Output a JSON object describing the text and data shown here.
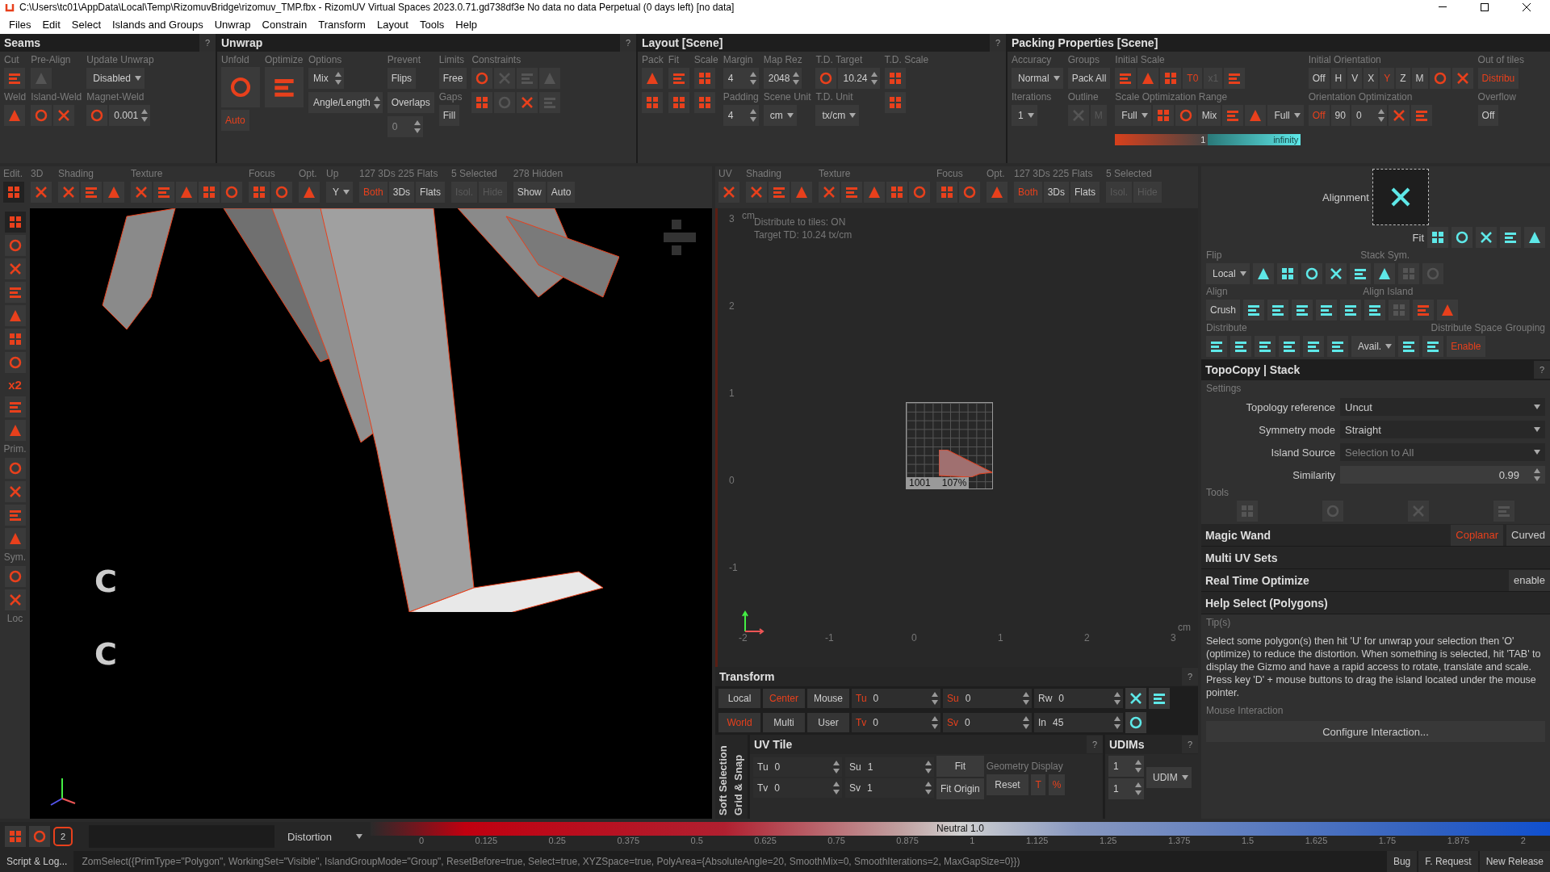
{
  "title_bar": {
    "title": "C:\\Users\\tc01\\AppData\\Local\\Temp\\RizomuvBridge\\rizomuv_TMP.fbx - RizomUV  Virtual Spaces 2023.0.71.gd738df3e No data no data Perpetual  (0 days left) [no data]"
  },
  "menu": [
    "Files",
    "Edit",
    "Select",
    "Islands and Groups",
    "Unwrap",
    "Constrain",
    "Transform",
    "Layout",
    "Tools",
    "Help"
  ],
  "top_panels": [
    {
      "title": "Seams",
      "help": "?",
      "columns": [
        [
          {
            "caption": "Cut",
            "items": [
              {
                "kind": "icon"
              }
            ]
          },
          {
            "caption": "Weld",
            "items": [
              {
                "kind": "icon"
              }
            ]
          }
        ],
        [
          {
            "caption": "Pre-Align",
            "items": [
              {
                "kind": "icon",
                "disabled": true
              }
            ]
          },
          {
            "caption": "Island-Weld",
            "items": [
              {
                "kind": "icon"
              },
              {
                "kind": "icon"
              }
            ]
          }
        ],
        [
          {
            "caption": "Update Unwrap",
            "items": [
              {
                "kind": "dropdown",
                "text": "Disabled"
              }
            ]
          },
          {
            "caption": "Magnet-Weld",
            "items": [
              {
                "kind": "icon"
              },
              {
                "kind": "spin",
                "text": "0.001"
              }
            ]
          }
        ]
      ]
    },
    {
      "title": "Unwrap",
      "help": "?",
      "columns": [
        [
          {
            "caption": "Unfold",
            "items": [
              {
                "kind": "bigicon"
              }
            ]
          },
          {
            "items": [
              {
                "kind": "button",
                "text": "Auto",
                "active": true
              }
            ]
          }
        ],
        [
          {
            "caption": "Optimize",
            "items": [
              {
                "kind": "bigicon"
              }
            ]
          }
        ],
        [
          {
            "caption": "Options",
            "items": [
              {
                "kind": "spin",
                "text": "Mix"
              }
            ]
          },
          {
            "items": [
              {
                "kind": "spin",
                "text": "Angle/Length"
              }
            ]
          }
        ],
        [
          {
            "caption": "Prevent",
            "items": [
              {
                "kind": "button",
                "text": "Flips"
              }
            ]
          },
          {
            "items": [
              {
                "kind": "button",
                "text": "Overlaps"
              }
            ]
          },
          {
            "items": [
              {
                "kind": "spin",
                "text": "0",
                "disabled": true
              }
            ]
          }
        ],
        [
          {
            "caption": "Limits",
            "items": [
              {
                "kind": "button",
                "text": "Free"
              }
            ]
          },
          {
            "caption": "Gaps",
            "items": [
              {
                "kind": "button",
                "text": "Fill"
              }
            ]
          }
        ],
        [
          {
            "caption": "Constraints",
            "items": [
              {
                "kind": "icon"
              },
              {
                "kind": "icon",
                "disabled": true
              },
              {
                "kind": "icon",
                "disabled": true
              },
              {
                "kind": "icon",
                "disabled": true
              }
            ]
          },
          {
            "items": [
              {
                "kind": "icon"
              },
              {
                "kind": "icon",
                "disabled": true
              },
              {
                "kind": "icon"
              },
              {
                "kind": "icon",
                "disabled": true
              }
            ]
          }
        ]
      ]
    },
    {
      "title": "Layout [Scene]",
      "help": "?",
      "columns": [
        [
          {
            "caption": "Pack",
            "items": [
              {
                "kind": "icon"
              }
            ]
          },
          {
            "items": [
              {
                "kind": "icon"
              }
            ]
          }
        ],
        [
          {
            "caption": "Fit",
            "items": [
              {
                "kind": "icon"
              }
            ]
          },
          {
            "items": [
              {
                "kind": "icon"
              }
            ]
          }
        ],
        [
          {
            "caption": "Scale",
            "items": [
              {
                "kind": "icon"
              }
            ]
          },
          {
            "items": [
              {
                "kind": "icon"
              }
            ]
          }
        ],
        [
          {
            "caption": "Margin",
            "items": [
              {
                "kind": "spin",
                "text": "4"
              }
            ]
          },
          {
            "caption": "Padding",
            "items": [
              {
                "kind": "spin",
                "text": "4"
              }
            ]
          }
        ],
        [
          {
            "caption": "Map Rez",
            "items": [
              {
                "kind": "spin",
                "text": "2048"
              }
            ]
          },
          {
            "caption": "Scene Unit",
            "items": [
              {
                "kind": "dropdown",
                "text": "cm"
              }
            ]
          }
        ],
        [
          {
            "caption": "T.D. Target",
            "items": [
              {
                "kind": "icon"
              },
              {
                "kind": "spin",
                "text": "10.24"
              }
            ]
          },
          {
            "caption": "T.D. Unit",
            "items": [
              {
                "kind": "dropdown",
                "text": "tx/cm"
              }
            ]
          }
        ],
        [
          {
            "caption": "T.D. Scale",
            "items": [
              {
                "kind": "icon"
              }
            ]
          },
          {
            "items": [
              {
                "kind": "icon"
              }
            ]
          }
        ]
      ]
    },
    {
      "title": "Packing Properties [Scene]",
      "columns": [
        [
          {
            "caption": "Accuracy",
            "items": [
              {
                "kind": "dropdown",
                "text": "Normal"
              }
            ]
          },
          {
            "caption": "Iterations",
            "items": [
              {
                "kind": "dropdown",
                "text": "1"
              }
            ]
          }
        ],
        [
          {
            "caption": "Groups",
            "items": [
              {
                "kind": "button",
                "text": "Pack All"
              }
            ]
          },
          {
            "caption": "Outline",
            "items": [
              {
                "kind": "icon",
                "disabled": true
              },
              {
                "kind": "button",
                "text": "M",
                "disabled": true
              }
            ]
          }
        ],
        [
          {
            "caption": "Initial Scale",
            "items": [
              {
                "kind": "icon"
              },
              {
                "kind": "icon"
              },
              {
                "kind": "icon"
              },
              {
                "kind": "button",
                "text": "T0",
                "active": true
              },
              {
                "kind": "button",
                "text": "x1",
                "disabled": true
              },
              {
                "kind": "icon"
              }
            ]
          },
          {
            "caption": "Scale Optimization Range",
            "items": [
              {
                "kind": "dropdown",
                "text": "Full"
              },
              {
                "kind": "icon"
              },
              {
                "kind": "icon"
              },
              {
                "kind": "button",
                "text": "Mix"
              },
              {
                "kind": "icon"
              },
              {
                "kind": "icon"
              },
              {
                "kind": "dropdown",
                "text": "Full"
              }
            ]
          },
          {
            "items": [
              {
                "kind": "range",
                "low": "1",
                "high": "infinity"
              }
            ]
          }
        ],
        [
          {
            "caption": "Initial Orientation",
            "items": [
              {
                "kind": "button",
                "text": "Off"
              },
              {
                "kind": "button",
                "text": "H"
              },
              {
                "kind": "button",
                "text": "V"
              },
              {
                "kind": "button",
                "text": "X"
              },
              {
                "kind": "button",
                "text": "Y",
                "active": true
              },
              {
                "kind": "button",
                "text": "Z"
              },
              {
                "kind": "button",
                "text": "M"
              },
              {
                "kind": "icon"
              },
              {
                "kind": "icon"
              }
            ]
          },
          {
            "caption": "Orientation Optimization",
            "items": [
              {
                "kind": "button",
                "text": "Off",
                "active": true
              },
              {
                "kind": "button",
                "text": "90"
              },
              {
                "kind": "spin",
                "text": "0"
              },
              {
                "kind": "icon"
              },
              {
                "kind": "icon"
              }
            ]
          }
        ],
        [
          {
            "caption": "Out of tiles",
            "items": [
              {
                "kind": "button",
                "text": "Distribu",
                "active": true
              }
            ]
          },
          {
            "caption": "Overflow",
            "items": [
              {
                "kind": "button",
                "text": "Off"
              }
            ]
          }
        ]
      ]
    }
  ],
  "viewport_3d": {
    "toolbar": [
      {
        "caption": "Edit.",
        "items": [
          {
            "kind": "icon",
            "active": true
          }
        ]
      },
      {
        "caption": "3D",
        "items": [
          {
            "kind": "icon"
          }
        ]
      },
      {
        "caption": "Shading",
        "items": [
          {
            "kind": "icon"
          },
          {
            "kind": "icon"
          },
          {
            "kind": "icon"
          }
        ]
      },
      {
        "caption": "Texture",
        "items": [
          {
            "kind": "icon"
          },
          {
            "kind": "icon"
          },
          {
            "kind": "icon"
          },
          {
            "kind": "icon"
          },
          {
            "kind": "icon"
          }
        ]
      },
      {
        "caption": "Focus",
        "items": [
          {
            "kind": "icon"
          },
          {
            "kind": "icon"
          }
        ]
      },
      {
        "caption": "Opt.",
        "items": [
          {
            "kind": "icon"
          }
        ]
      },
      {
        "caption": "Up",
        "items": [
          {
            "kind": "dropdown",
            "text": "Y"
          }
        ]
      },
      {
        "caption": "127 3Ds 225 Flats",
        "items": [
          {
            "kind": "button",
            "text": "Both",
            "active": true
          },
          {
            "kind": "button",
            "text": "3Ds"
          },
          {
            "kind": "button",
            "text": "Flats"
          }
        ]
      },
      {
        "caption": "5 Selected",
        "items": [
          {
            "kind": "button",
            "text": "Isol.",
            "disabled": true
          },
          {
            "kind": "button",
            "text": "Hide",
            "disabled": true
          }
        ]
      },
      {
        "caption": "278 Hidden",
        "items": [
          {
            "kind": "button",
            "text": "Show"
          },
          {
            "kind": "button",
            "text": "Auto"
          }
        ]
      }
    ],
    "tools": [
      {
        "kind": "icon",
        "active": true
      },
      {
        "kind": "icon"
      },
      {
        "kind": "icon"
      },
      {
        "kind": "icon"
      },
      {
        "kind": "icon"
      },
      {
        "kind": "icon"
      },
      {
        "kind": "icon"
      },
      {
        "kind": "label",
        "text": "x2"
      },
      {
        "kind": "icon"
      },
      {
        "kind": "icon"
      },
      {
        "kind": "caption",
        "text": "Prim."
      },
      {
        "kind": "icon"
      },
      {
        "kind": "icon"
      },
      {
        "kind": "icon"
      },
      {
        "kind": "icon"
      },
      {
        "kind": "caption",
        "text": "Sym."
      },
      {
        "kind": "icon"
      },
      {
        "kind": "icon"
      },
      {
        "kind": "caption",
        "text": "Loc"
      }
    ],
    "marks": [
      "C",
      "C"
    ]
  },
  "viewport_uv": {
    "toolbar": [
      {
        "caption": "UV",
        "items": [
          {
            "kind": "icon"
          }
        ]
      },
      {
        "caption": "Shading",
        "items": [
          {
            "kind": "icon"
          },
          {
            "kind": "icon"
          },
          {
            "kind": "icon"
          }
        ]
      },
      {
        "caption": "Texture",
        "items": [
          {
            "kind": "icon"
          },
          {
            "kind": "icon"
          },
          {
            "kind": "icon"
          },
          {
            "kind": "icon"
          },
          {
            "kind": "icon"
          }
        ]
      },
      {
        "caption": "Focus",
        "items": [
          {
            "kind": "icon"
          },
          {
            "kind": "icon"
          }
        ]
      },
      {
        "caption": "Opt.",
        "items": [
          {
            "kind": "icon"
          }
        ]
      },
      {
        "caption": "127 3Ds 225 Flats",
        "items": [
          {
            "kind": "button",
            "text": "Both",
            "active": true
          },
          {
            "kind": "button",
            "text": "3Ds"
          },
          {
            "kind": "button",
            "text": "Flats"
          }
        ]
      },
      {
        "caption": "5 Selected",
        "items": [
          {
            "kind": "button",
            "text": "Isol.",
            "disabled": true
          },
          {
            "kind": "button",
            "text": "Hide",
            "disabled": true
          }
        ]
      }
    ],
    "info": [
      "Distribute to tiles: ON",
      "Target TD: 10.24 tx/cm"
    ],
    "y_axis": [
      "3",
      "2",
      "1",
      "0",
      "-1"
    ],
    "y_unit": "cm",
    "x_axis": [
      "-2",
      "-1",
      "0",
      "1",
      "2",
      "3"
    ],
    "x_unit": "cm",
    "tile": {
      "number": "1001",
      "percent": "107%"
    }
  },
  "transform": {
    "title": "Transform",
    "help": "?",
    "modes": [
      [
        {
          "text": "Local",
          "selected": false
        },
        {
          "text": "Center",
          "selected": true
        },
        {
          "text": "Mouse",
          "selected": false
        }
      ],
      [
        {
          "text": "World",
          "selected": true
        },
        {
          "text": "Multi",
          "selected": false
        },
        {
          "text": "User",
          "selected": false
        }
      ]
    ],
    "fields": [
      [
        {
          "label": "Tu",
          "value": "0"
        },
        {
          "label": "Su",
          "value": "0"
        },
        {
          "label": "Rw",
          "value": "0"
        }
      ],
      [
        {
          "label": "Tv",
          "value": "0"
        },
        {
          "label": "Sv",
          "value": "0"
        },
        {
          "label": "In",
          "value": "45"
        }
      ]
    ],
    "side_tabs": [
      "Soft Selection",
      "Grid & Snap"
    ]
  },
  "uv_tile": {
    "title": "UV Tile",
    "help": "?",
    "fields": [
      [
        {
          "label": "Tu",
          "value": "0"
        },
        {
          "label": "Su",
          "value": "1"
        }
      ],
      [
        {
          "label": "Tv",
          "value": "0"
        },
        {
          "label": "Sv",
          "value": "1"
        }
      ]
    ],
    "buttons": [
      "Fit",
      "Fit Origin"
    ],
    "geometry": {
      "caption": "Geometry",
      "button": "Reset"
    },
    "display": {
      "caption": "Display",
      "buttons": [
        "T",
        "%"
      ]
    }
  },
  "udims": {
    "title": "UDIMs",
    "help": "?",
    "values": [
      "1",
      "1"
    ],
    "mode": "UDIM"
  },
  "right_panel": {
    "alignment": "Alignment",
    "fit": "Fit",
    "flip": {
      "caption": "Flip",
      "mode": "Local"
    },
    "stack_sym": "Stack Sym.",
    "align": {
      "caption": "Align",
      "button": "Crush"
    },
    "align_island": "Align Island",
    "distribute": "Distribute",
    "distribute_space": {
      "caption": "Distribute Space",
      "mode": "Avail."
    },
    "grouping": {
      "caption": "Grouping",
      "button": "Enable"
    },
    "topocopy": {
      "title": "TopoCopy | Stack",
      "help": "?",
      "settings": "Settings",
      "rows": [
        {
          "label": "Topology reference",
          "value": "Uncut",
          "disabled": false
        },
        {
          "label": "Symmetry mode",
          "value": "Straight",
          "disabled": false
        },
        {
          "label": "Island Source",
          "value": "Selection to All",
          "disabled": true
        }
      ],
      "similarity": {
        "label": "Similarity",
        "value": "0.99"
      },
      "tools": "Tools"
    },
    "sections": [
      {
        "title": "Magic Wand",
        "buttons": [
          {
            "text": "Coplanar",
            "selected": true
          },
          {
            "text": "Curved",
            "selected": false
          }
        ]
      },
      {
        "title": "Multi UV Sets"
      },
      {
        "title": "Real Time Optimize",
        "buttons": [
          {
            "text": "enable",
            "selected": false
          }
        ]
      },
      {
        "title": "Help Select (Polygons)"
      }
    ],
    "tips": {
      "caption": "Tip(s)",
      "text": "Select some polygon(s) then hit 'U' for unwrap your selection then 'O' (optimize) to reduce the distortion. When something is selected, hit 'TAB' to display the Gizmo and have a rapid access to rotate, translate and scale. Press key 'D' + mouse buttons to drag the island located under the mouse pointer."
    },
    "mouse": {
      "caption": "Mouse Interaction",
      "button": "Configure Interaction..."
    }
  },
  "distortion_bar": {
    "mode": "Distortion",
    "ticks": [
      "0",
      "0.125",
      "0.25",
      "0.375",
      "0.5",
      "0.625",
      "0.75",
      "0.875",
      "1",
      "1.125",
      "1.25",
      "1.375",
      "1.5",
      "1.625",
      "1.75",
      "1.875",
      "2"
    ],
    "neutral": "Neutral 1.0",
    "badge": "2"
  },
  "status_bar": {
    "script": "Script & Log...",
    "command": "ZomSelect({PrimType=\"Polygon\", WorkingSet=\"Visible\", IslandGroupMode=\"Group\", ResetBefore=true, Select=true, XYZSpace=true, PolyArea={AbsoluteAngle=20, SmoothMix=0, SmoothIterations=2, MaxGapSize=0}})",
    "buttons": [
      "Bug",
      "F. Request",
      "New Release"
    ]
  }
}
